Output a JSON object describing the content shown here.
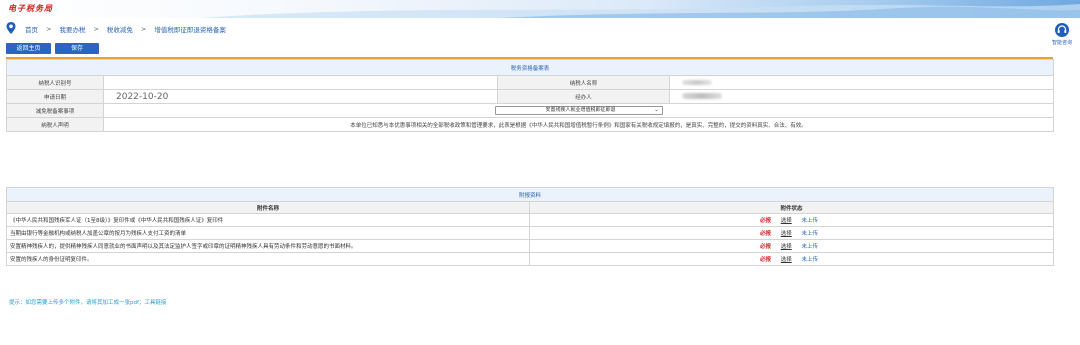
{
  "header": {
    "logo_text": "电子税务局"
  },
  "breadcrumb": {
    "items": [
      "首页",
      "我要办税",
      "税收减免",
      "增值税即征即退资格备案"
    ],
    "separator": ">"
  },
  "help": {
    "label": "智能咨询"
  },
  "toolbar": {
    "back_label": "返回主页",
    "save_label": "保存"
  },
  "form": {
    "title": "税务资格备案表",
    "taxpayer_id_label": "纳税人识别号",
    "taxpayer_name_label": "纳税人名称",
    "apply_date_label": "申请日期",
    "apply_date_value": "2022-10-20",
    "handler_label": "经办人",
    "reduction_item_label": "减免税备案事项",
    "reduction_item_value": "安置残疾人就业增值税即征即退",
    "declaration_label": "纳税人声明",
    "declaration_text": "本单位已知悉与本优惠事项相关的全部税收政策和管理要求，此表是根据《中华人民共和国增值税暂行条例》和国家有关税收规定填报的，是真实、完整的，提交的资料真实、合法、有效。"
  },
  "attachments": {
    "title": "附报资料",
    "col_name": "附件名称",
    "col_status": "附件状态",
    "rows": [
      {
        "name": "《中华人民共和国残疾军人证（1至8级）》复印件或《中华人民共和国残疾人证》复印件",
        "required": "必报",
        "select": "选择",
        "state": "未上传"
      },
      {
        "name": "当期由银行等金融机构或纳税人加盖公章的按月为残疾人支付工资的清单",
        "required": "必报",
        "select": "选择",
        "state": "未上传"
      },
      {
        "name": "安置精神残疾人的，提供精神残疾人同意就业的书面声明以及其法定监护人签字或印章的证明精神残疾人具有劳动条件和劳动意愿的书面材料。",
        "required": "必报",
        "select": "选择",
        "state": "未上传"
      },
      {
        "name": "安置的残疾人的身份证明复印件。",
        "required": "必报",
        "select": "选择",
        "state": "未上传"
      }
    ]
  },
  "tip": "提示：如您需要上传多个附件，请将其加工成一张pdf；工具链接",
  "colors": {
    "accent_blue": "#2b64c4",
    "orange_rule": "#f0a030",
    "required_red": "#d42b2b"
  }
}
